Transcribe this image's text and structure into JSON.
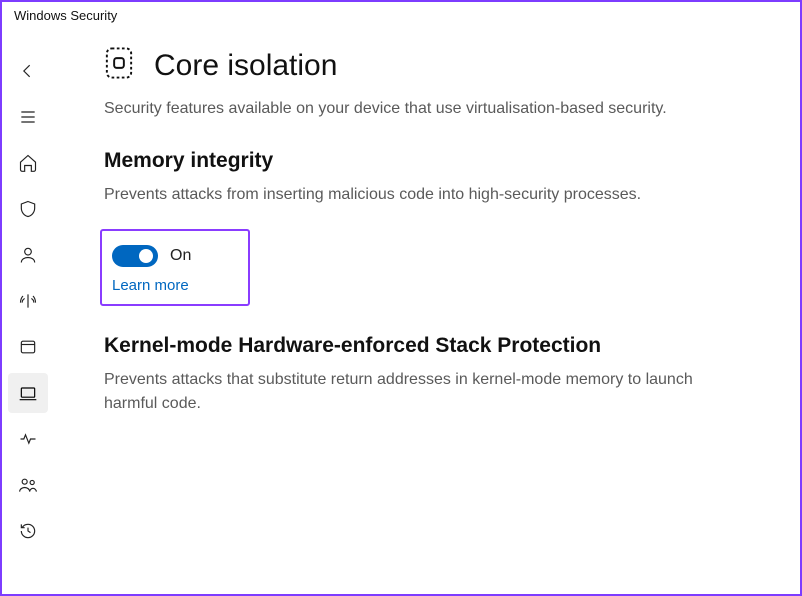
{
  "window": {
    "title": "Windows Security"
  },
  "sidebar": {
    "items": [
      {
        "name": "back",
        "icon": "arrow-left"
      },
      {
        "name": "menu",
        "icon": "menu"
      },
      {
        "name": "home",
        "icon": "home"
      },
      {
        "name": "virus",
        "icon": "shield"
      },
      {
        "name": "account",
        "icon": "user"
      },
      {
        "name": "firewall",
        "icon": "wifi"
      },
      {
        "name": "app-browser",
        "icon": "window"
      },
      {
        "name": "device-security",
        "icon": "laptop",
        "active": true
      },
      {
        "name": "performance",
        "icon": "heart"
      },
      {
        "name": "family",
        "icon": "people"
      },
      {
        "name": "history",
        "icon": "history"
      }
    ]
  },
  "page": {
    "title": "Core isolation",
    "description": "Security features available on your device that use virtualisation-based security.",
    "sections": [
      {
        "title": "Memory integrity",
        "description": "Prevents attacks from inserting malicious code into high-security processes.",
        "toggle": {
          "state": "On",
          "learn_more": "Learn more"
        }
      },
      {
        "title": "Kernel-mode Hardware-enforced Stack Protection",
        "description": "Prevents attacks that substitute return addresses in kernel-mode memory to launch harmful code."
      }
    ]
  },
  "colors": {
    "accent": "#0067c0",
    "highlight": "#8a3cff"
  }
}
